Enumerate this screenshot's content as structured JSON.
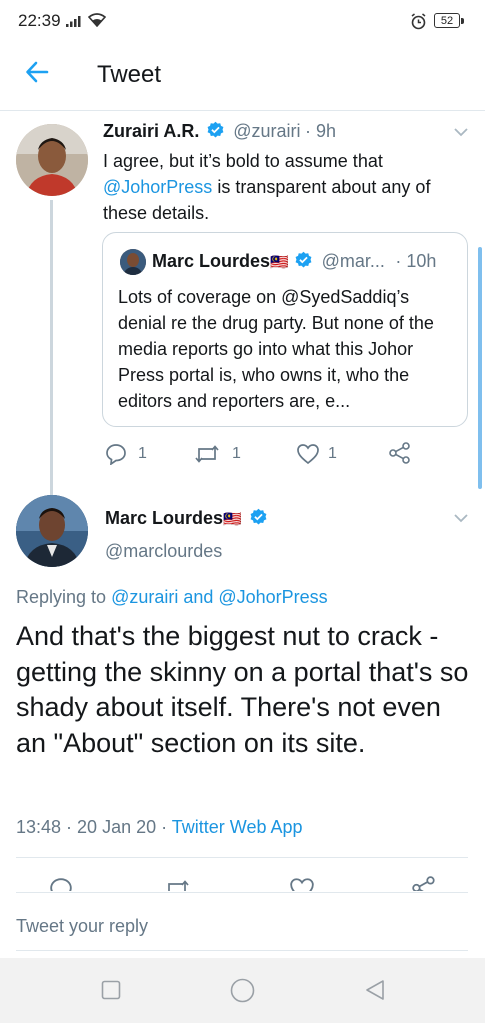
{
  "status_bar": {
    "time": "22:39",
    "battery": "52"
  },
  "app_bar": {
    "title": "Tweet"
  },
  "parent_tweet": {
    "name": "Zurairi A.R.",
    "handle": "@zurairi",
    "time": "· 9h",
    "text_before": "I agree, but it’s bold to assume that ",
    "mention": "@JohorPress",
    "text_after": " is transparent about any of these details.",
    "quote": {
      "name": "Marc Lourdes",
      "flag": "🇲🇾",
      "handle": "@mar...",
      "time": "· 10h",
      "text": "Lots of coverage on @SyedSaddiq’s denial re the drug party. But none of the media reports go into what this Johor Press portal is, who owns it, who the editors and reporters are, e..."
    },
    "actions": {
      "replies": "1",
      "retweets": "1",
      "likes": "1"
    }
  },
  "main_tweet": {
    "name": "Marc Lourdes",
    "flag": "🇲🇾",
    "handle": "@marclourdes",
    "replying_prefix": "Replying to ",
    "replying_to": "@zurairi and @JohorPress",
    "text": "And that's the biggest nut to crack - getting the skinny on a portal that's so shady about itself. There's not even an \"About\" section on its site.",
    "timestamp": "13:48 · 20 Jan 20 · ",
    "source": "Twitter Web App"
  },
  "reply_bar": {
    "placeholder": "Tweet your reply"
  },
  "colors": {
    "link": "#1b95e0",
    "verified": "#1da1f2",
    "muted": "#657786"
  }
}
